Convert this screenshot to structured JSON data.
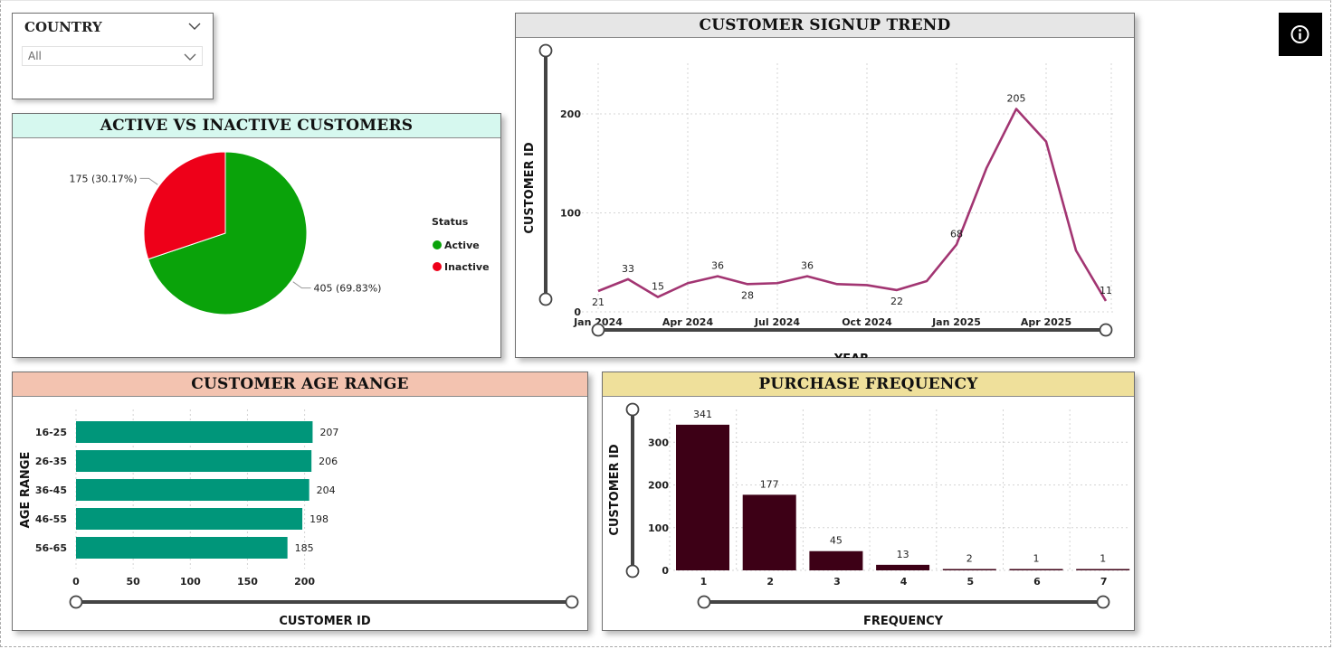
{
  "slicer": {
    "label": "COUNTRY",
    "selected": "All"
  },
  "charts": {
    "pie": {
      "title": "ACTIVE VS INACTIVE CUSTOMERS",
      "bg": "#d6f8ef",
      "legend_title": "Status",
      "slices": [
        {
          "name": "Active",
          "value": 405,
          "label": "405 (69.83%)",
          "color": "#0aa30a"
        },
        {
          "name": "Inactive",
          "value": 175,
          "label": "175 (30.17%)",
          "color": "#ee0019"
        }
      ]
    },
    "trend": {
      "title": "CUSTOMER SIGNUP TREND",
      "bg": "#e6e6e6",
      "xlabel": "YEAR",
      "ylabel": "CUSTOMER ID",
      "line_color": "#a23572"
    },
    "age": {
      "title": "CUSTOMER AGE RANGE",
      "bg": "#f3c3b0",
      "xlabel": "CUSTOMER ID",
      "ylabel": "AGE RANGE",
      "bar_color": "#00967a"
    },
    "freq": {
      "title": "PURCHASE FREQUENCY",
      "bg": "#efe09b",
      "xlabel": "FREQUENCY",
      "ylabel": "CUSTOMER ID",
      "bar_color": "#3d0016"
    }
  },
  "chart_data": [
    {
      "type": "pie",
      "title": "ACTIVE VS INACTIVE CUSTOMERS",
      "legend_title": "Status",
      "categories": [
        "Active",
        "Inactive"
      ],
      "values": [
        405,
        175
      ],
      "labels": [
        "405 (69.83%)",
        "175 (30.17%)"
      ],
      "legend_position": "right"
    },
    {
      "type": "line",
      "title": "CUSTOMER SIGNUP TREND",
      "xlabel": "YEAR",
      "ylabel": "CUSTOMER ID",
      "x": [
        "2024-01",
        "2024-02",
        "2024-03",
        "2024-04",
        "2024-05",
        "2024-06",
        "2024-07",
        "2024-08",
        "2024-09",
        "2024-10",
        "2024-11",
        "2024-12",
        "2025-01",
        "2025-02",
        "2025-03",
        "2025-04",
        "2025-05",
        "2025-06"
      ],
      "x_ticks": [
        "Jan 2024",
        "Apr 2024",
        "Jul 2024",
        "Oct 2024",
        "Jan 2025",
        "Apr 2025"
      ],
      "values": [
        21,
        33,
        15,
        29,
        36,
        28,
        29,
        36,
        28,
        27,
        22,
        31,
        68,
        145,
        205,
        172,
        62,
        11
      ],
      "data_labels": {
        "0": "21",
        "1": "33",
        "2": "15",
        "4": "36",
        "5": "28",
        "7": "36",
        "10": "22",
        "12": "68",
        "14": "205",
        "17": "11"
      },
      "yticks": [
        0,
        100,
        200
      ],
      "ylim": [
        0,
        240
      ],
      "grid": true
    },
    {
      "type": "bar",
      "orientation": "horizontal",
      "title": "CUSTOMER AGE RANGE",
      "xlabel": "CUSTOMER ID",
      "ylabel": "AGE RANGE",
      "categories": [
        "16-25",
        "26-35",
        "36-45",
        "46-55",
        "56-65"
      ],
      "values": [
        207,
        206,
        204,
        198,
        185
      ],
      "xticks": [
        0,
        50,
        100,
        150,
        200
      ],
      "xlim": [
        0,
        215
      ],
      "grid": true
    },
    {
      "type": "bar",
      "title": "PURCHASE FREQUENCY",
      "xlabel": "FREQUENCY",
      "ylabel": "CUSTOMER ID",
      "categories": [
        "1",
        "2",
        "3",
        "4",
        "5",
        "6",
        "7"
      ],
      "values": [
        341,
        177,
        45,
        13,
        2,
        1,
        1
      ],
      "yticks": [
        0,
        100,
        200,
        300
      ],
      "ylim": [
        0,
        390
      ],
      "grid": true
    }
  ]
}
